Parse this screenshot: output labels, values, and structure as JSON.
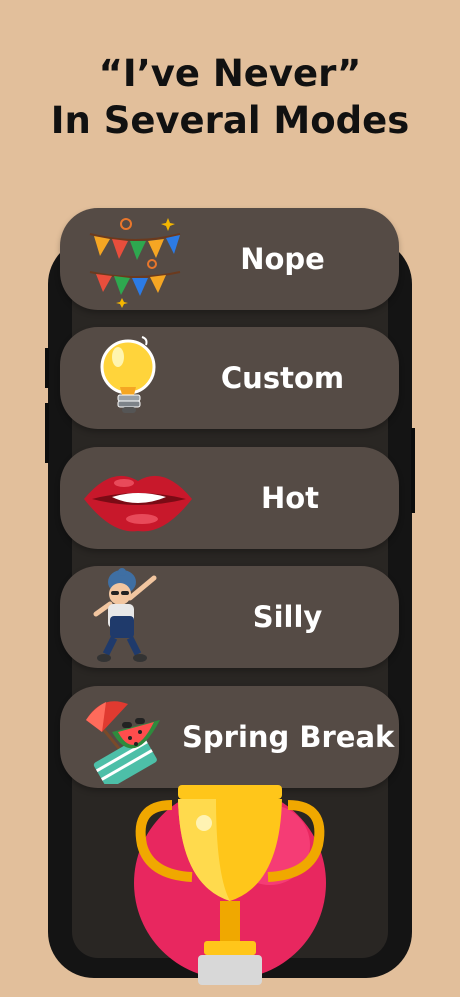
{
  "headline": {
    "line1": "“I’ve Never”",
    "line2": "In Several Modes"
  },
  "modes": [
    {
      "label": "Nope",
      "icon": "party-bunting-icon"
    },
    {
      "label": "Custom",
      "icon": "light-bulb-icon"
    },
    {
      "label": "Hot",
      "icon": "lips-icon"
    },
    {
      "label": "Silly",
      "icon": "dabbing-kid-icon"
    },
    {
      "label": "Spring Break",
      "icon": "beach-umbrella-watermelon-icon"
    }
  ],
  "decor": {
    "trophy": "trophy-icon"
  },
  "colors": {
    "background": "#e2bf9b",
    "phone": "#141414",
    "screen": "#292623",
    "mode_card": "#554b45",
    "text_primary": "#111111",
    "card_text": "#ffffff"
  }
}
